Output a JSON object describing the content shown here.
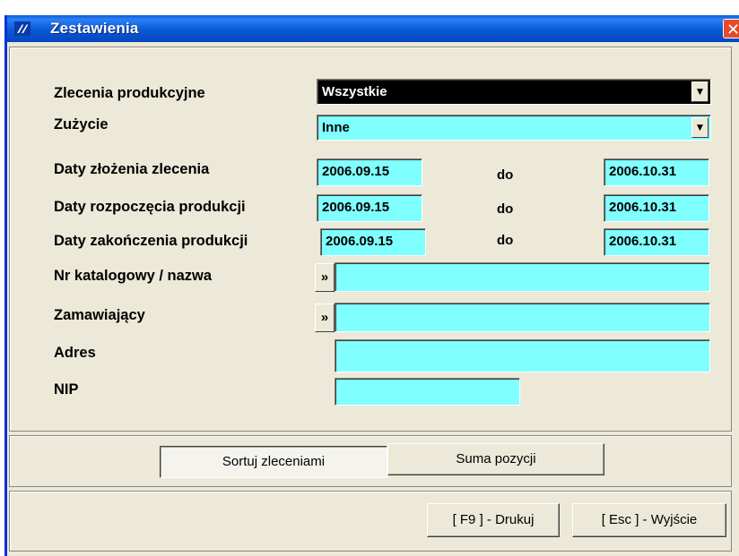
{
  "window": {
    "title": "Zestawienia",
    "close_glyph": "✕"
  },
  "form": {
    "zlecenia_label": "Zlecenia produkcyjne",
    "zlecenia_value": "Wszystkie",
    "zuzycie_label": "Zużycie",
    "zuzycie_value": "Inne",
    "daty_zlozenia_label": "Daty złożenia zlecenia",
    "daty_rozpoczecia_label": "Daty rozpoczęcia produkcji",
    "daty_zakonczenia_label": "Daty zakończenia produkcji",
    "date_from_1": "2006.09.15",
    "date_to_1": "2006.10.31",
    "date_from_2": "2006.09.15",
    "date_to_2": "2006.10.31",
    "date_from_3": "2006.09.15",
    "date_to_3": "2006.10.31",
    "do_label": "do",
    "nr_katalogowy_label": "Nr katalogowy / nazwa",
    "nr_katalogowy_value": "",
    "zamawiajacy_label": "Zamawiający",
    "zamawiajacy_value": "",
    "adres_label": "Adres",
    "adres_value": "",
    "nip_label": "NIP",
    "nip_value": "",
    "lookup_glyph": "»"
  },
  "sort": {
    "sortuj_label": "Sortuj zleceniami",
    "suma_label": "Suma pozycji"
  },
  "actions": {
    "drukuj_label": "[ F9 ] - Drukuj",
    "wyjscie_label": "[ Esc ] - Wyjście"
  },
  "icons": {
    "dropdown": "▼",
    "app_icon": "app-logo-icon"
  },
  "colors": {
    "field_bg": "#80ffff",
    "title_bar": "#0a5bdb",
    "window_bg": "#ece9d8"
  }
}
